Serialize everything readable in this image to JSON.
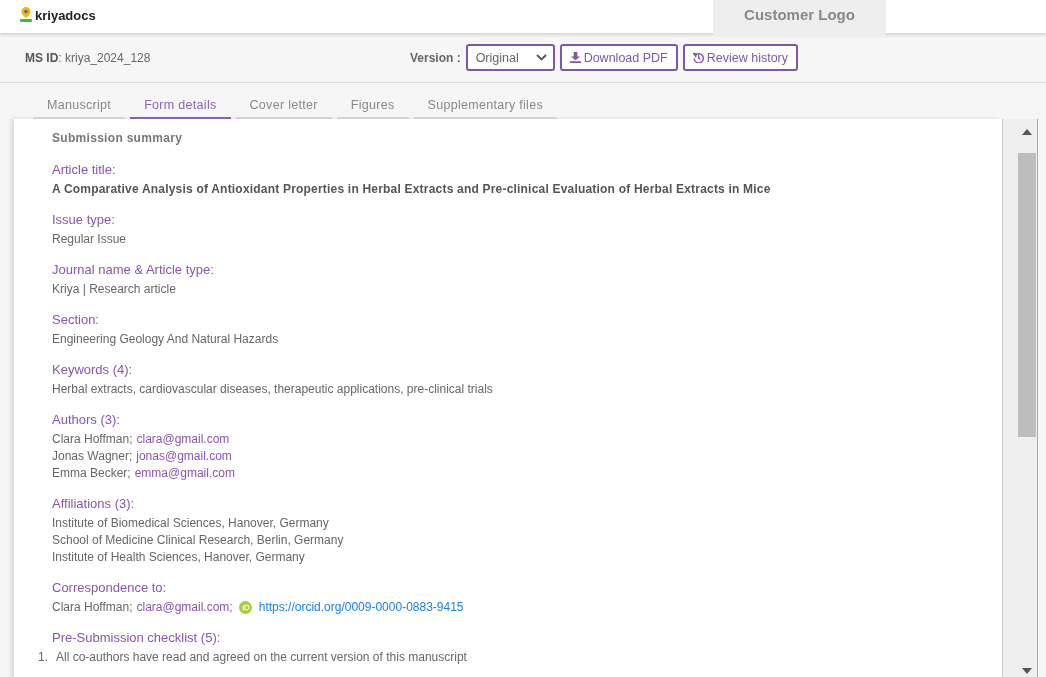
{
  "header": {
    "brand": "kriyadocs",
    "customer_logo": "Customer Logo"
  },
  "toolbar": {
    "ms_id": "**MS ID**: kriya_2024_128",
    "version_label": "Version :",
    "version": "Original",
    "buttons": [
      {
        "kind": "download",
        "label": "Download PDF"
      },
      {
        "kind": "history",
        "label": "Review history"
      }
    ]
  },
  "tabs": [
    {
      "label": "Manuscript",
      "selected": false
    },
    {
      "label": "Form details",
      "selected": true
    },
    {
      "label": "Cover letter",
      "selected": false
    },
    {
      "label": "Figures",
      "selected": false
    },
    {
      "label": "Supplementary files",
      "selected": false
    }
  ],
  "content": {
    "heading": "Submission summary",
    "sections": [
      {
        "kind": "title",
        "label": "Article title:",
        "lines": [
          "A Comparative Analysis of Antioxidant Properties in Herbal Extracts and Pre-clinical Evaluation of Herbal Extracts in Mice"
        ]
      },
      {
        "kind": "lines",
        "label": "Issue type:",
        "lines": [
          "Regular Issue"
        ]
      },
      {
        "kind": "lines",
        "label": "Journal name & Article type:",
        "lines": [
          "Kriya | Research article"
        ]
      },
      {
        "kind": "lines",
        "label": "Section:",
        "lines": [
          "Engineering Geology And Natural Hazards"
        ]
      },
      {
        "kind": "lines",
        "label": "Keywords (4):",
        "lines": [
          "Herbal extracts, cardiovascular diseases, therapeutic applications, pre-clinical trials"
        ]
      },
      {
        "kind": "people",
        "label": "Authors (3):",
        "people": [
          {
            "name": "Clara Hoffman;",
            "email": "clara@gmail.com"
          },
          {
            "name": "Jonas Wagner;",
            "email": "jonas@gmail.com"
          },
          {
            "name": "Emma Becker;",
            "email": "emma@gmail.com"
          }
        ]
      },
      {
        "kind": "lines",
        "label": "Affiliations (3):",
        "lines": [
          "Institute of Biomedical Sciences, Hanover, Germany",
          "School of Medicine Clinical Research, Berlin, Germany",
          "Institute of Health Sciences, Hanover, Germany"
        ]
      },
      {
        "kind": "correspondence",
        "label": "Correspondence to:",
        "name": "Clara Hoffman;",
        "email": "clara@gmail.com;",
        "orcid": "https://orcid.org/0009-0000-0883-9415"
      },
      {
        "kind": "checklist",
        "label": "Pre-Submission checklist (5):",
        "items": [
          {
            "number": "1.",
            "text": "All co-authors have read and agreed on the current version of this manuscript"
          }
        ]
      }
    ]
  }
}
